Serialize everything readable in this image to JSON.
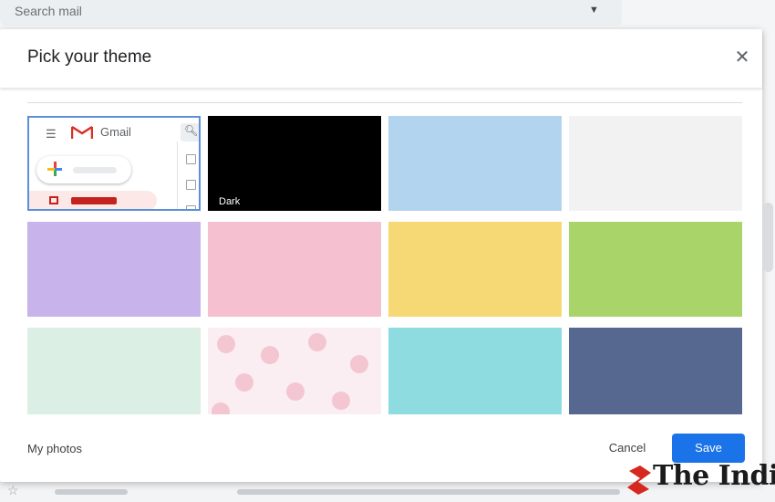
{
  "search": {
    "placeholder": "Search mail"
  },
  "dialog": {
    "title": "Pick your theme",
    "close_icon": "close-icon",
    "footer": {
      "my_photos_label": "My photos",
      "cancel_label": "Cancel",
      "save_label": "Save"
    }
  },
  "themes": [
    {
      "id": "default",
      "label": "",
      "brand": "Gmail",
      "selected": true
    },
    {
      "id": "dark",
      "label": "Dark",
      "color": "#000000"
    },
    {
      "id": "light-blue",
      "label": "",
      "color": "#b2d4ef"
    },
    {
      "id": "light-gray",
      "label": "",
      "color": "#f2f2f2"
    },
    {
      "id": "lavender",
      "label": "",
      "color": "#c8b4ea"
    },
    {
      "id": "pink",
      "label": "",
      "color": "#f5c0d0"
    },
    {
      "id": "yellow",
      "label": "",
      "color": "#f6d874"
    },
    {
      "id": "green",
      "label": "",
      "color": "#a8d46a"
    },
    {
      "id": "mint",
      "label": "",
      "color": "#dcefe4"
    },
    {
      "id": "floral",
      "label": "",
      "color": "#fbeef2"
    },
    {
      "id": "turquoise",
      "label": "",
      "color": "#8edbe0"
    },
    {
      "id": "slate-blue",
      "label": "",
      "color": "#566890"
    }
  ],
  "watermark": {
    "text": "The Indi"
  },
  "colors": {
    "accent": "#1a73e8",
    "selected_border": "#5b8fd7"
  }
}
